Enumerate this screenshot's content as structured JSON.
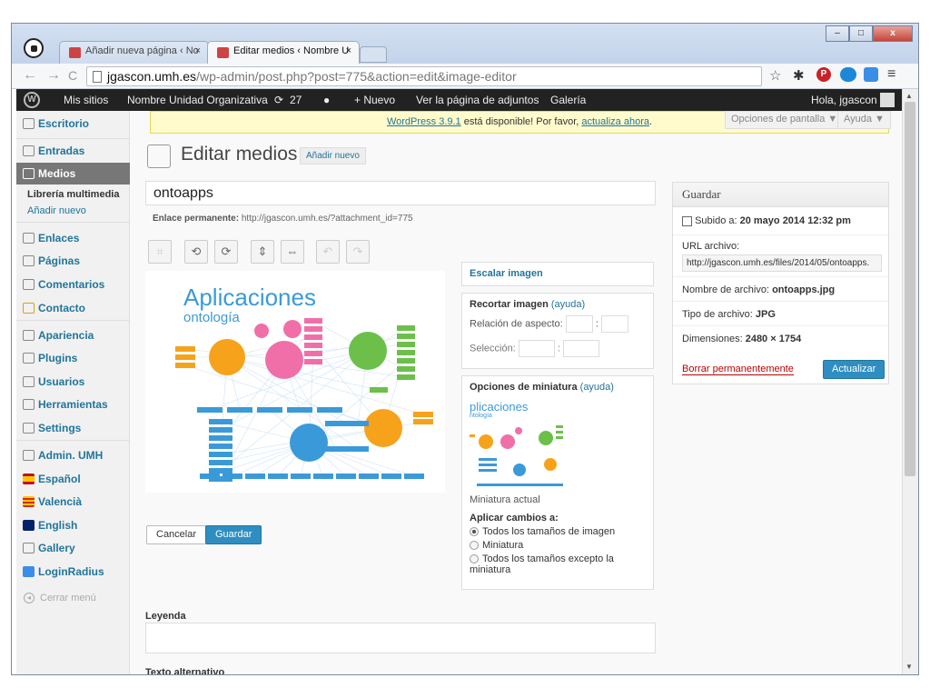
{
  "browser": {
    "tabs": [
      {
        "label": "Añadir nueva página ‹ No",
        "close": "×"
      },
      {
        "label": "Editar medios ‹ Nombre U",
        "close": "×"
      }
    ],
    "window_buttons": {
      "minimize": "–",
      "maximize": "□",
      "close": "x"
    },
    "url_host": "jgascon.umh.es",
    "url_path": "/wp-admin/post.php?post=775&action=edit&image-editor",
    "nav": {
      "back": "←",
      "forward": "→",
      "reload": "C"
    },
    "ext_icons": {
      "star": "☆",
      "bug": "✱",
      "pin": "P",
      "menu": "≡"
    }
  },
  "adminbar": {
    "my_sites": "Mis sitios",
    "site_name": "Nombre Unidad Organizativa",
    "updates": "27",
    "new": "+ Nuevo",
    "view_attachment": "Ver la página de adjuntos",
    "gallery": "Galería",
    "greeting": "Hola, jgascon"
  },
  "sidebar": {
    "items": [
      {
        "label": "Escritorio"
      },
      {
        "label": "Entradas"
      },
      {
        "label": "Medios"
      },
      {
        "label": "Enlaces"
      },
      {
        "label": "Páginas"
      },
      {
        "label": "Comentarios"
      },
      {
        "label": "Contacto"
      },
      {
        "label": "Apariencia"
      },
      {
        "label": "Plugins"
      },
      {
        "label": "Usuarios"
      },
      {
        "label": "Herramientas"
      },
      {
        "label": "Settings"
      },
      {
        "label": "Admin. UMH"
      },
      {
        "label": "Español"
      },
      {
        "label": "Valencià"
      },
      {
        "label": "English"
      },
      {
        "label": "Gallery"
      },
      {
        "label": "LoginRadius"
      }
    ],
    "submenu": {
      "library": "Librería multimedia",
      "add_new": "Añadir nuevo"
    },
    "collapse": "Cerrar menú"
  },
  "notice": {
    "link1": "WordPress 3.9.1",
    "text": " está disponible! Por favor, ",
    "link2": "actualiza ahora",
    "end": "."
  },
  "screen_options": "Opciones de pantalla ▼",
  "help": "Ayuda ▼",
  "page": {
    "title": "Editar medios",
    "add_new": "Añadir nuevo",
    "media_title": "ontoapps",
    "permalink_label": "Enlace permanente:",
    "permalink_url": "http://jgascon.umh.es/?attachment_id=775"
  },
  "image": {
    "title": "Aplicaciones",
    "subtitle": "ontología",
    "colors": {
      "blue": "#3a9ad9",
      "pink": "#f06fa8",
      "orange": "#f7a21b",
      "green": "#6cc04a",
      "red": "#e2452f"
    }
  },
  "editor_buttons": {
    "cancel": "Cancelar",
    "save": "Guardar"
  },
  "scale": {
    "heading": "Escalar imagen"
  },
  "crop": {
    "heading": "Recortar imagen",
    "help": "(ayuda)",
    "ratio_label": "Relación de aspecto:",
    "selection_label": "Selección:",
    "separator": ":"
  },
  "thumb": {
    "heading": "Opciones de miniatura",
    "help": "(ayuda)",
    "mini_title": "plicaciones",
    "mini_sub": "ntología",
    "current": "Miniatura actual",
    "apply_label": "Aplicar cambios a:",
    "options": [
      "Todos los tamaños de imagen",
      "Miniatura",
      "Todos los tamaños excepto la miniatura"
    ]
  },
  "fields": {
    "caption": "Leyenda",
    "alt": "Texto alternativo"
  },
  "savebox": {
    "heading": "Guardar",
    "uploaded_label": "Subido a:",
    "uploaded_date": "20 mayo 2014 12:32 pm",
    "url_label": "URL archivo:",
    "url_value": "http://jgascon.umh.es/files/2014/05/ontoapps.",
    "filename_label": "Nombre de archivo:",
    "filename": "ontoapps.jpg",
    "filetype_label": "Tipo de archivo:",
    "filetype": "JPG",
    "dims_label": "Dimensiones:",
    "dims": "2480 × 1754",
    "delete": "Borrar permanentemente",
    "update": "Actualizar"
  }
}
